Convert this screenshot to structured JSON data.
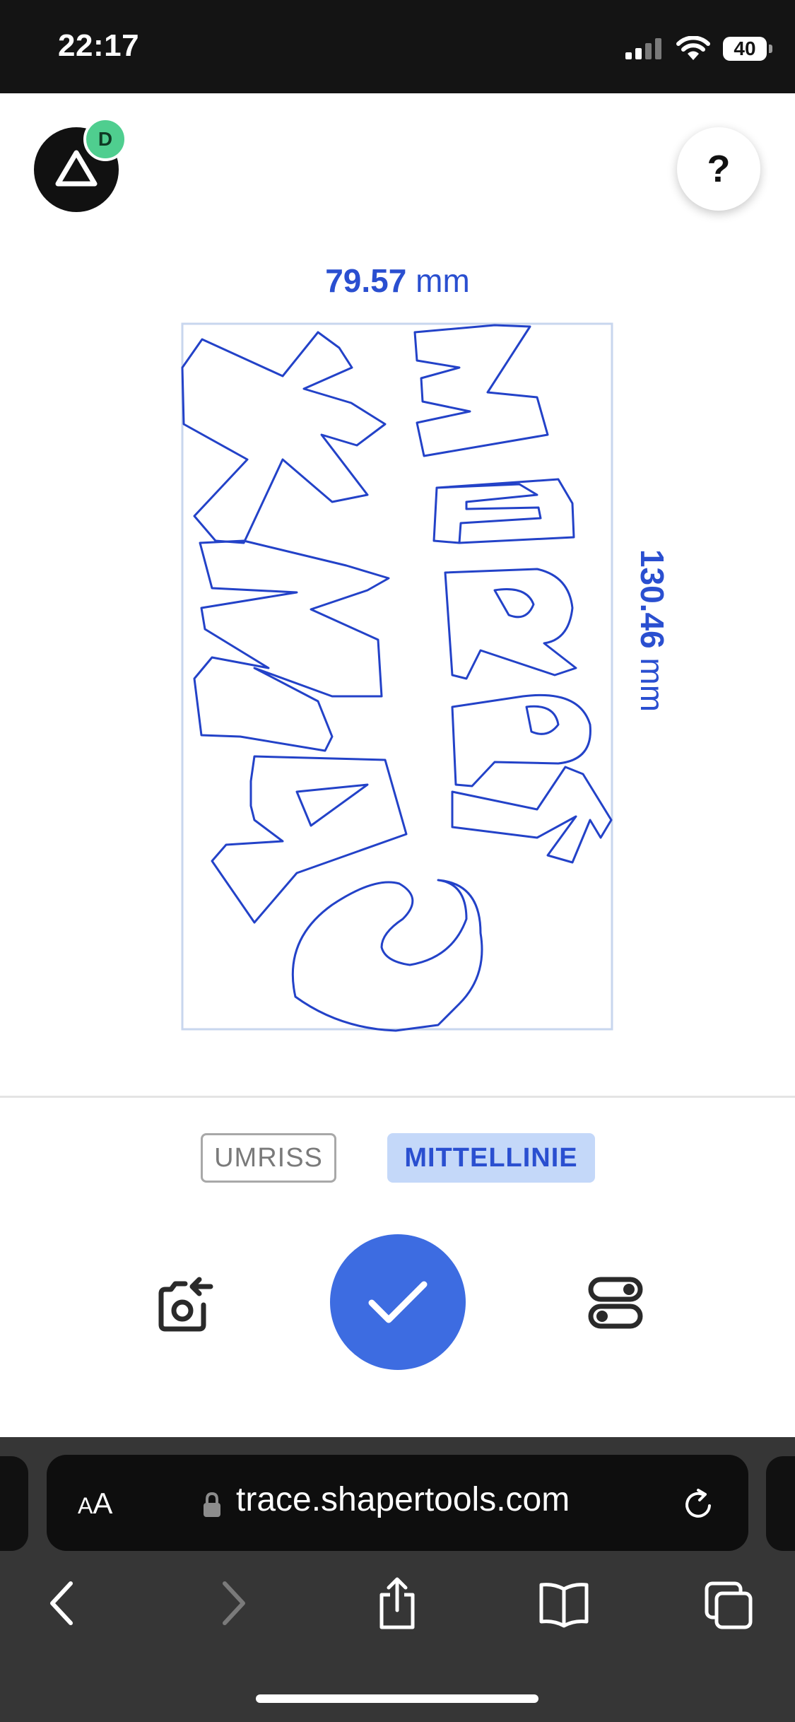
{
  "status_bar": {
    "time": "22:17",
    "battery": "40",
    "icons": [
      "signal-icon",
      "wifi-icon",
      "battery-icon"
    ]
  },
  "header": {
    "logo_icon": "triangle-logo-icon",
    "avatar_initial": "D",
    "help_label": "?"
  },
  "dimensions": {
    "width_value": "79.57",
    "width_unit": " mm",
    "height_value": "130.46",
    "height_unit": " mm"
  },
  "trace": {
    "stroke_color": "#2342c8",
    "frame_color": "#c8d6ee"
  },
  "modes": {
    "outline_label": "UMRISS",
    "centerline_label": "MITTELLINIE",
    "selected": "MITTELLINIE"
  },
  "actions": {
    "retake_icon": "camera-retake-icon",
    "confirm_icon": "checkmark-icon",
    "settings_icon": "toggles-icon"
  },
  "browser": {
    "aa_label_big": "A",
    "aa_label_small": "A",
    "url": "trace.shapertools.com",
    "nav_icons": [
      "back-icon",
      "forward-icon",
      "share-icon",
      "bookmarks-icon",
      "tabs-icon"
    ]
  },
  "colors": {
    "accent": "#3d6ce1",
    "dimension_text": "#2a4fd0",
    "mode_selected_bg": "#c4d8f9",
    "avatar": "#4fce8f"
  }
}
